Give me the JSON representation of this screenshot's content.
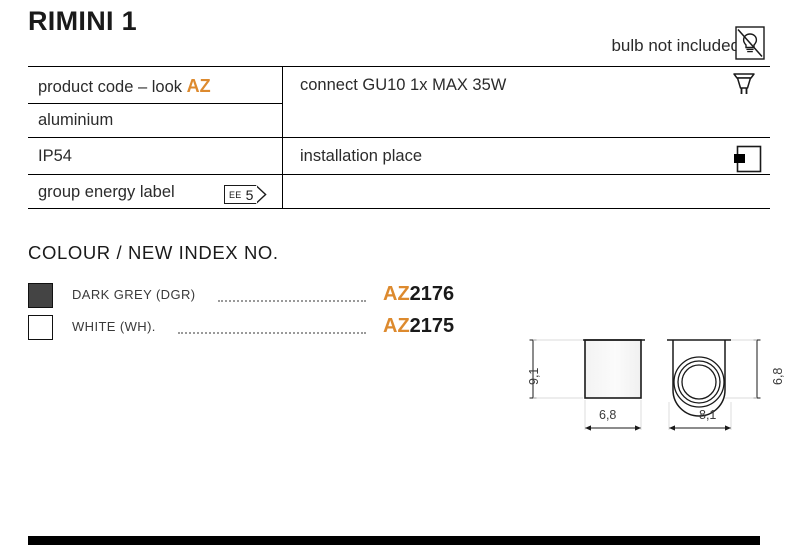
{
  "product": {
    "title": "RIMINI 1",
    "bulb_note": "bulb not included"
  },
  "icons": {
    "bulb_crossed": "bulb-not-included-icon",
    "gu10": "gu10-bulb-icon",
    "mount": "installation-place-icon"
  },
  "spec_table": {
    "left": [
      {
        "label_prefix": "product code – look ",
        "label_accent": "AZ"
      },
      {
        "label_prefix": "aluminium",
        "label_accent": ""
      },
      {
        "label_prefix": "IP54",
        "label_accent": ""
      },
      {
        "label_prefix": "group energy label",
        "label_accent": ""
      }
    ],
    "energy_label": {
      "prefix": "EE",
      "value": "5"
    },
    "right": [
      {
        "text": "connect GU10 1x MAX 35W"
      },
      {
        "text": "installation place"
      }
    ]
  },
  "colour_section": {
    "heading": "COLOUR / NEW INDEX NO.",
    "rows": [
      {
        "name": "DARK GREY (DGR)",
        "swatch_hex": "#444444",
        "code_prefix": "AZ",
        "code_number": "2176"
      },
      {
        "name": "WHITE (WH).",
        "swatch_hex": "#ffffff",
        "code_prefix": "AZ",
        "code_number": "2175"
      }
    ]
  },
  "drawings": {
    "side_view": {
      "height": "9,1",
      "width": "6,8"
    },
    "top_view": {
      "height": "6,8",
      "width": "8,1"
    }
  },
  "colors": {
    "accent": "#dd8a2e",
    "ink": "#1a1a1a"
  }
}
